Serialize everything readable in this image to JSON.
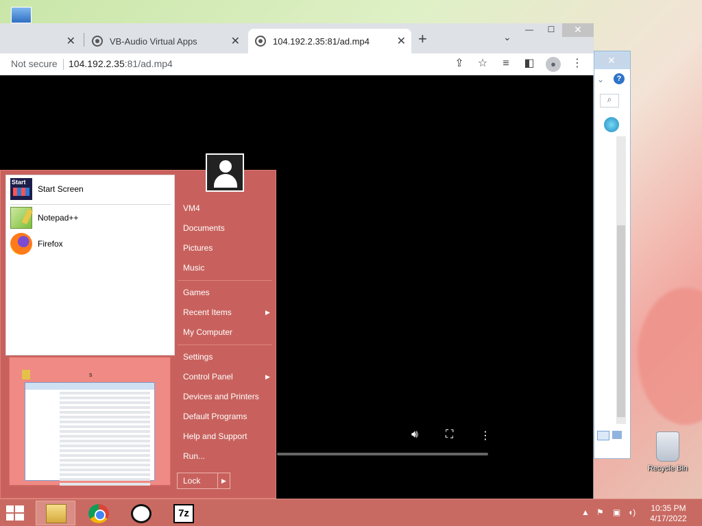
{
  "browser": {
    "tabs": [
      {
        "label": ""
      },
      {
        "label": "VB-Audio Virtual Apps"
      },
      {
        "label": "104.192.2.35:81/ad.mp4"
      }
    ],
    "address": {
      "security": "Not secure",
      "host": "104.192.2.35",
      "rest": ":81/ad.mp4"
    }
  },
  "start_menu": {
    "pinned": [
      {
        "label": "Start Screen",
        "icon": "start-screen-icon"
      },
      {
        "label": "Notepad++",
        "icon": "notepadpp-icon"
      },
      {
        "label": "Firefox",
        "icon": "firefox-icon"
      }
    ],
    "preview_label": "s",
    "links_group1": [
      "VM4",
      "Documents",
      "Pictures",
      "Music"
    ],
    "links_group2": [
      {
        "label": "Games",
        "submenu": false
      },
      {
        "label": "Recent Items",
        "submenu": true
      },
      {
        "label": "My Computer",
        "submenu": false
      }
    ],
    "links_group3": [
      {
        "label": "Settings",
        "submenu": false
      },
      {
        "label": "Control Panel",
        "submenu": true
      },
      {
        "label": "Devices and Printers",
        "submenu": false
      },
      {
        "label": "Default Programs",
        "submenu": false
      },
      {
        "label": "Help and Support",
        "submenu": false
      },
      {
        "label": "Run...",
        "submenu": false
      }
    ],
    "lock_label": "Lock"
  },
  "desktop": {
    "recycle_bin_label": "Recycle Bin"
  },
  "taskbar": {
    "apps": [
      "file-explorer-icon",
      "chrome-icon",
      "sync-app-icon",
      "7zip-icon"
    ],
    "clock_time": "10:35 PM",
    "clock_date": "4/17/2022"
  },
  "colors": {
    "accent": "#c8615d",
    "taskbar": "#c96a62"
  }
}
